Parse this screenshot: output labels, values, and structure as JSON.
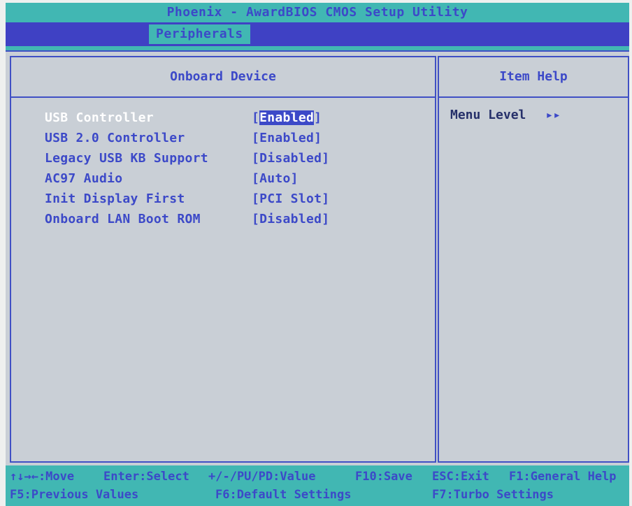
{
  "title": "Phoenix - AwardBIOS CMOS Setup Utility",
  "menu": {
    "active_tab": "Peripherals"
  },
  "left_panel": {
    "header": "Onboard Device",
    "items": [
      {
        "label": "USB Controller",
        "value": "Enabled",
        "selected": true
      },
      {
        "label": "USB 2.0 Controller",
        "value": "[Enabled]"
      },
      {
        "label": "Legacy USB KB Support",
        "value": "[Disabled]"
      },
      {
        "label": "AC97 Audio",
        "value": "[Auto]"
      },
      {
        "label": "Init Display First",
        "value": "[PCI Slot]"
      },
      {
        "label": "Onboard LAN Boot ROM",
        "value": "[Disabled]"
      }
    ]
  },
  "right_panel": {
    "header": "Item Help",
    "menu_level_label": "Menu Level",
    "menu_level_arrows": "▸▸"
  },
  "bottom_bar": {
    "row1": [
      "↑↓→←:Move",
      "Enter:Select",
      "+/-/PU/PD:Value",
      "F10:Save",
      "ESC:Exit",
      "F1:General Help"
    ],
    "row2": [
      "F5:Previous Values",
      "F6:Default Settings",
      "F7:Turbo Settings"
    ]
  },
  "colors": {
    "cyan_bar": "#41b7b3",
    "blue": "#3c49c8",
    "panel_bg": "#c9cfd6",
    "selected_text": "#ffffff"
  }
}
